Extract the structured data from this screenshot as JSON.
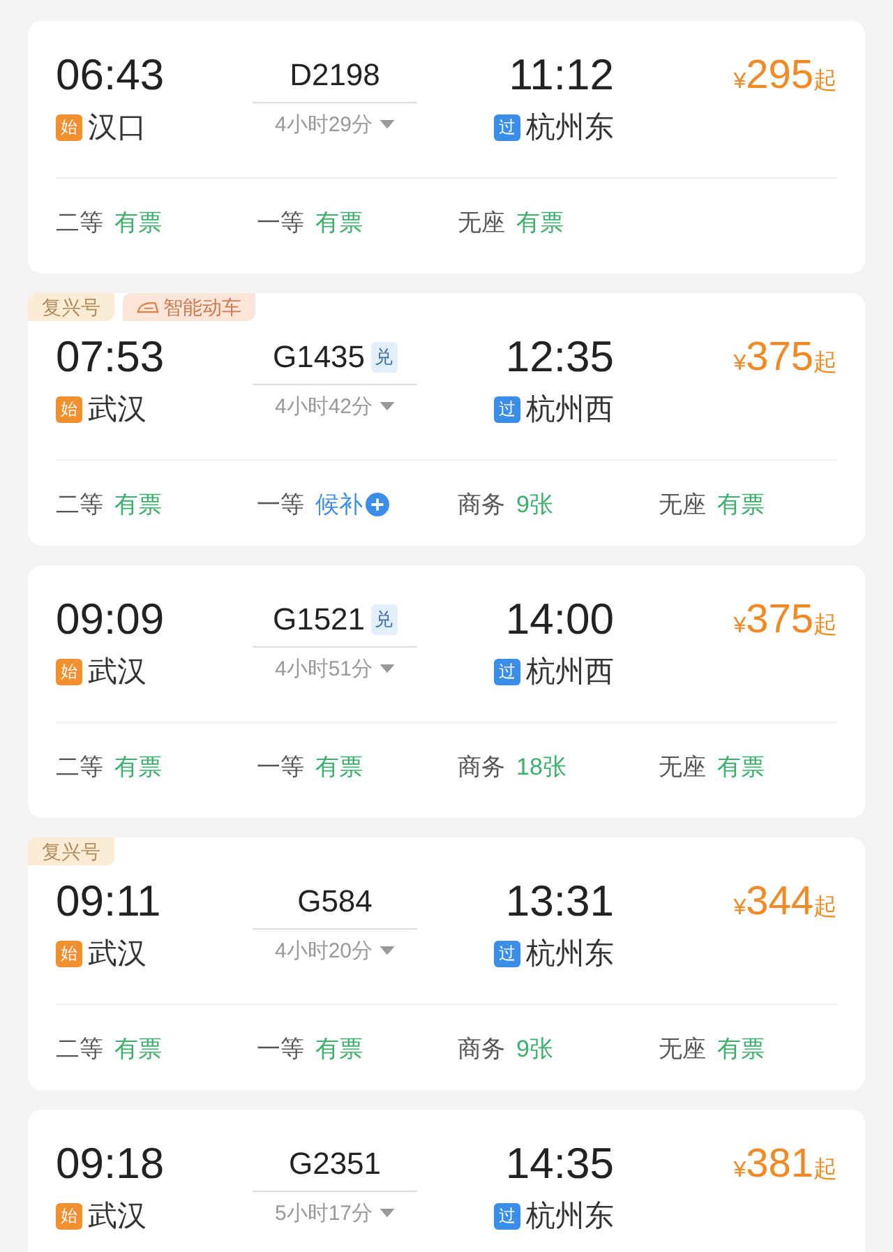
{
  "trains": [
    {
      "depart": "06:43",
      "number": "D2198",
      "arrive": "11:12",
      "price": {
        "currency": "¥",
        "amount": "295",
        "suffix": "起"
      },
      "from": {
        "badge": "始",
        "name": "汉口"
      },
      "duration": "4小时29分",
      "to": {
        "badge": "过",
        "name": "杭州东"
      },
      "seats": [
        {
          "class": "二等",
          "status": "有票",
          "kind": "available"
        },
        {
          "class": "一等",
          "status": "有票",
          "kind": "available"
        },
        {
          "class": "无座",
          "status": "有票",
          "kind": "available"
        }
      ]
    },
    {
      "tags": [
        {
          "kind": "plain",
          "label": "复兴号"
        },
        {
          "kind": "smart",
          "label": "智能动车"
        }
      ],
      "depart": "07:53",
      "number": "G1435",
      "exchange": "兑",
      "arrive": "12:35",
      "price": {
        "currency": "¥",
        "amount": "375",
        "suffix": "起"
      },
      "from": {
        "badge": "始",
        "name": "武汉"
      },
      "duration": "4小时42分",
      "to": {
        "badge": "过",
        "name": "杭州西"
      },
      "seats": [
        {
          "class": "二等",
          "status": "有票",
          "kind": "available"
        },
        {
          "class": "一等",
          "status": "候补",
          "kind": "waitlist"
        },
        {
          "class": "商务",
          "status": "9张",
          "kind": "available"
        },
        {
          "class": "无座",
          "status": "有票",
          "kind": "available"
        }
      ]
    },
    {
      "depart": "09:09",
      "number": "G1521",
      "exchange": "兑",
      "arrive": "14:00",
      "price": {
        "currency": "¥",
        "amount": "375",
        "suffix": "起"
      },
      "from": {
        "badge": "始",
        "name": "武汉"
      },
      "duration": "4小时51分",
      "to": {
        "badge": "过",
        "name": "杭州西"
      },
      "seats": [
        {
          "class": "二等",
          "status": "有票",
          "kind": "available"
        },
        {
          "class": "一等",
          "status": "有票",
          "kind": "available"
        },
        {
          "class": "商务",
          "status": "18张",
          "kind": "available"
        },
        {
          "class": "无座",
          "status": "有票",
          "kind": "available"
        }
      ]
    },
    {
      "tags": [
        {
          "kind": "plain",
          "label": "复兴号"
        }
      ],
      "depart": "09:11",
      "number": "G584",
      "arrive": "13:31",
      "price": {
        "currency": "¥",
        "amount": "344",
        "suffix": "起"
      },
      "from": {
        "badge": "始",
        "name": "武汉"
      },
      "duration": "4小时20分",
      "to": {
        "badge": "过",
        "name": "杭州东"
      },
      "seats": [
        {
          "class": "二等",
          "status": "有票",
          "kind": "available"
        },
        {
          "class": "一等",
          "status": "有票",
          "kind": "available"
        },
        {
          "class": "商务",
          "status": "9张",
          "kind": "available"
        },
        {
          "class": "无座",
          "status": "有票",
          "kind": "available"
        }
      ]
    },
    {
      "depart": "09:18",
      "number": "G2351",
      "arrive": "14:35",
      "price": {
        "currency": "¥",
        "amount": "381",
        "suffix": "起"
      },
      "from": {
        "badge": "始",
        "name": "武汉"
      },
      "duration": "5小时17分",
      "to": {
        "badge": "过",
        "name": "杭州东"
      }
    }
  ]
}
